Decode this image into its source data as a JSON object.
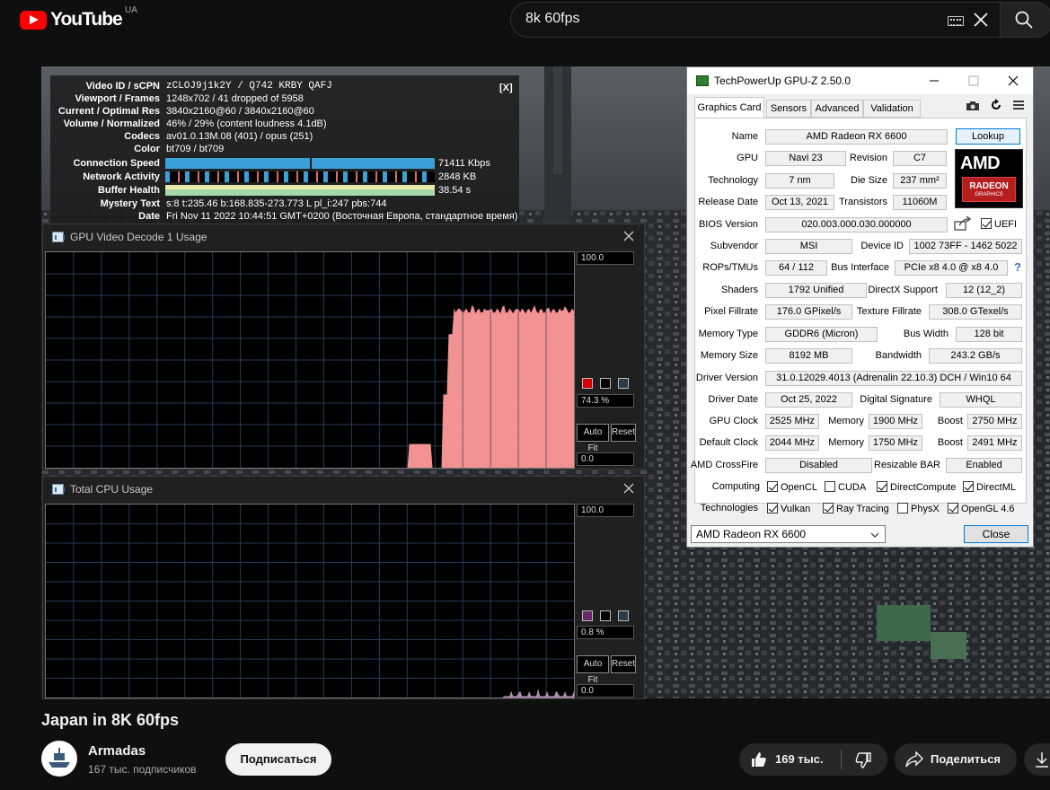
{
  "youtube": {
    "logo_text": "YouTube",
    "country": "UA",
    "search_value": "8k 60fps",
    "video_title": "Japan in 8K 60fps",
    "channel_name": "Armadas",
    "subscribers": "167 тыс. подписчиков",
    "subscribe_label": "Подписаться",
    "like_count": "169 тыс.",
    "share_label": "Поделиться"
  },
  "stats": {
    "close_label": "[X]",
    "rows": [
      {
        "label": "Video ID / sCPN",
        "value": "zCLOJ9j1k2Y / Q742 KRBY QAFJ"
      },
      {
        "label": "Viewport / Frames",
        "value": "1248x702 / 41 dropped of 5958"
      },
      {
        "label": "Current / Optimal Res",
        "value": "3840x2160@60 / 3840x2160@60"
      },
      {
        "label": "Volume / Normalized",
        "value": "46% / 29% (content loudness 4.1dB)"
      },
      {
        "label": "Codecs",
        "value": "av01.0.13M.08 (401) / opus (251)"
      },
      {
        "label": "Color",
        "value": "bt709 / bt709"
      },
      {
        "label": "Connection Speed",
        "value": "71411 Kbps"
      },
      {
        "label": "Network Activity",
        "value": "2848 KB"
      },
      {
        "label": "Buffer Health",
        "value": "38.54 s"
      },
      {
        "label": "Mystery Text",
        "value": "s:8 t:235.46 b:168.835-273.773 L pl_i:247 pbs:744"
      },
      {
        "label": "Date",
        "value": "Fri Nov 11 2022 10:44:51 GMT+0200 (Восточная Европа, стандартное время)"
      }
    ]
  },
  "gpu_decode_window": {
    "title": "GPU Video Decode 1 Usage",
    "max_label": "100.0",
    "min_label": "0.0",
    "current_value": "74.3 %",
    "current_percent": 74.3,
    "autofit_label": "Auto Fit",
    "reset_label": "Reset",
    "line_color": "#ff9a9a",
    "swatch_color": "#d40000"
  },
  "cpu_window": {
    "title": "Total CPU Usage",
    "max_label": "100.0",
    "min_label": "0.0",
    "current_value": "0.8 %",
    "current_percent": 0.8,
    "autofit_label": "Auto Fit",
    "reset_label": "Reset",
    "line_color": "#b48ab4",
    "swatch_color": "#6a2a6a"
  },
  "gpuz": {
    "title": "TechPowerUp GPU-Z 2.50.0",
    "tabs": [
      "Graphics Card",
      "Sensors",
      "Advanced",
      "Validation"
    ],
    "lookup_label": "Lookup",
    "logo_text": "AMD",
    "logo_sub1": "RADEON",
    "logo_sub2": "GRAPHICS",
    "name_label": "Name",
    "name": "AMD Radeon RX 6600",
    "gpu_label": "GPU",
    "gpu": "Navi 23",
    "revision_label": "Revision",
    "revision": "C7",
    "technology_label": "Technology",
    "technology": "7 nm",
    "die_size_label": "Die Size",
    "die_size": "237 mm²",
    "release_date_label": "Release Date",
    "release_date": "Oct 13, 2021",
    "transistors_label": "Transistors",
    "transistors": "11060M",
    "bios_label": "BIOS Version",
    "bios": "020.003.000.030.000000",
    "uefi_label": "UEFI",
    "subvendor_label": "Subvendor",
    "subvendor": "MSI",
    "device_id_label": "Device ID",
    "device_id": "1002 73FF - 1462 5022",
    "rops_label": "ROPs/TMUs",
    "rops": "64 / 112",
    "bus_label": "Bus Interface",
    "bus": "PCIe x8 4.0 @ x8 4.0",
    "help_label": "?",
    "shaders_label": "Shaders",
    "shaders": "1792 Unified",
    "directx_label": "DirectX Support",
    "directx": "12 (12_2)",
    "pixel_label": "Pixel Fillrate",
    "pixel": "176.0 GPixel/s",
    "texture_label": "Texture Fillrate",
    "texture": "308.0 GTexel/s",
    "memtype_label": "Memory Type",
    "memtype": "GDDR6 (Micron)",
    "buswidth_label": "Bus Width",
    "buswidth": "128 bit",
    "memsize_label": "Memory Size",
    "memsize": "8192 MB",
    "bandwidth_label": "Bandwidth",
    "bandwidth": "243.2 GB/s",
    "driver_version_label": "Driver Version",
    "driver_version": "31.0.12029.4013 (Adrenalin 22.10.3) DCH / Win10 64",
    "driver_date_label": "Driver Date",
    "driver_date": "Oct 25, 2022",
    "digsig_label": "Digital Signature",
    "digsig": "WHQL",
    "gpu_clock_label": "GPU Clock",
    "gpu_clock": "2525 MHz",
    "memory_label": "Memory",
    "gpu_memory": "1900 MHz",
    "boost_label": "Boost",
    "gpu_boost": "2750 MHz",
    "default_clock_label": "Default Clock",
    "default_clock": "2044 MHz",
    "default_memory": "1750 MHz",
    "default_boost": "2491 MHz",
    "crossfire_label": "AMD CrossFire",
    "crossfire": "Disabled",
    "rebar_label": "Resizable BAR",
    "rebar": "Enabled",
    "computing_label": "Computing",
    "computing": [
      "OpenCL",
      "CUDA",
      "DirectCompute",
      "DirectML"
    ],
    "technologies_label": "Technologies",
    "technologies": [
      "Vulkan",
      "Ray Tracing",
      "PhysX",
      "OpenGL 4.6"
    ],
    "selected_gpu": "AMD Radeon RX 6600",
    "close_label": "Close"
  }
}
